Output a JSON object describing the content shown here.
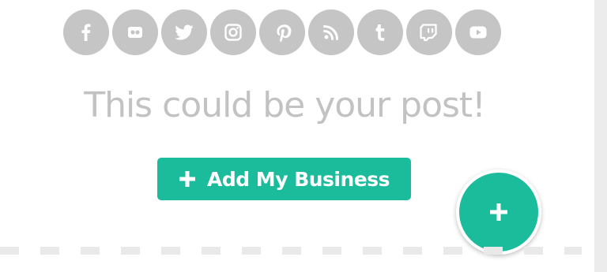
{
  "social": {
    "icons": [
      {
        "name": "facebook-icon"
      },
      {
        "name": "flickr-icon"
      },
      {
        "name": "twitter-icon"
      },
      {
        "name": "instagram-icon"
      },
      {
        "name": "pinterest-icon"
      },
      {
        "name": "rss-icon"
      },
      {
        "name": "tumblr-icon"
      },
      {
        "name": "twitch-icon"
      },
      {
        "name": "youtube-icon"
      }
    ],
    "icon_bg_color": "#c5c5c5",
    "icon_fg_color": "#ffffff"
  },
  "main": {
    "headline": "This could be your post!",
    "add_button_label": "Add My Business",
    "add_button_icon": "plus-icon",
    "fab_icon": "plus-icon"
  },
  "colors": {
    "accent": "#1abc9c",
    "headline_text": "#c2c2c2",
    "divider": "#e9e9e9"
  }
}
